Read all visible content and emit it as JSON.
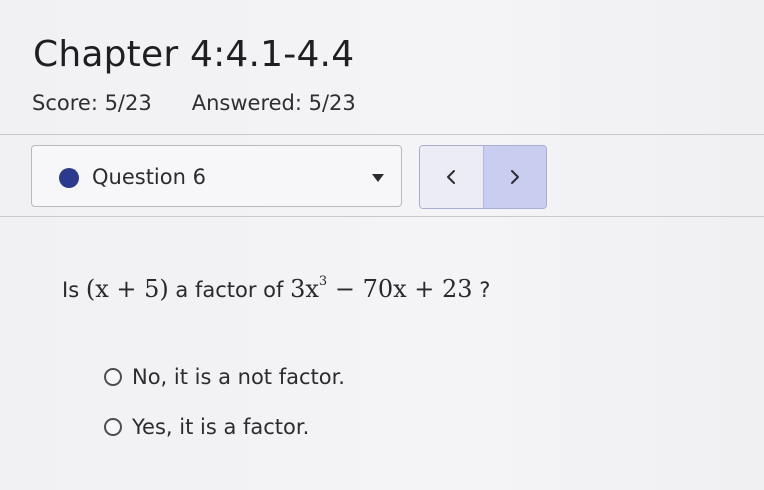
{
  "header": {
    "title": "Chapter 4:4.1-4.4",
    "score": "Score: 5/23",
    "answered": "Answered: 5/23"
  },
  "question_nav": {
    "selected": "Question 6",
    "prev_icon": "chevron-left-icon",
    "next_icon": "chevron-right-icon",
    "status_color": "#2b3a8f",
    "next_bg": "#c9cdf0"
  },
  "question": {
    "prefix": "Is",
    "factor": "(x + 5)",
    "middle": "a factor of",
    "poly_base": "3x",
    "poly_exp": "3",
    "poly_rest": "− 70x + 23",
    "suffix": "?"
  },
  "options": [
    {
      "label": "No, it is a not factor.",
      "selected": false
    },
    {
      "label": "Yes, it is a factor.",
      "selected": false
    }
  ]
}
